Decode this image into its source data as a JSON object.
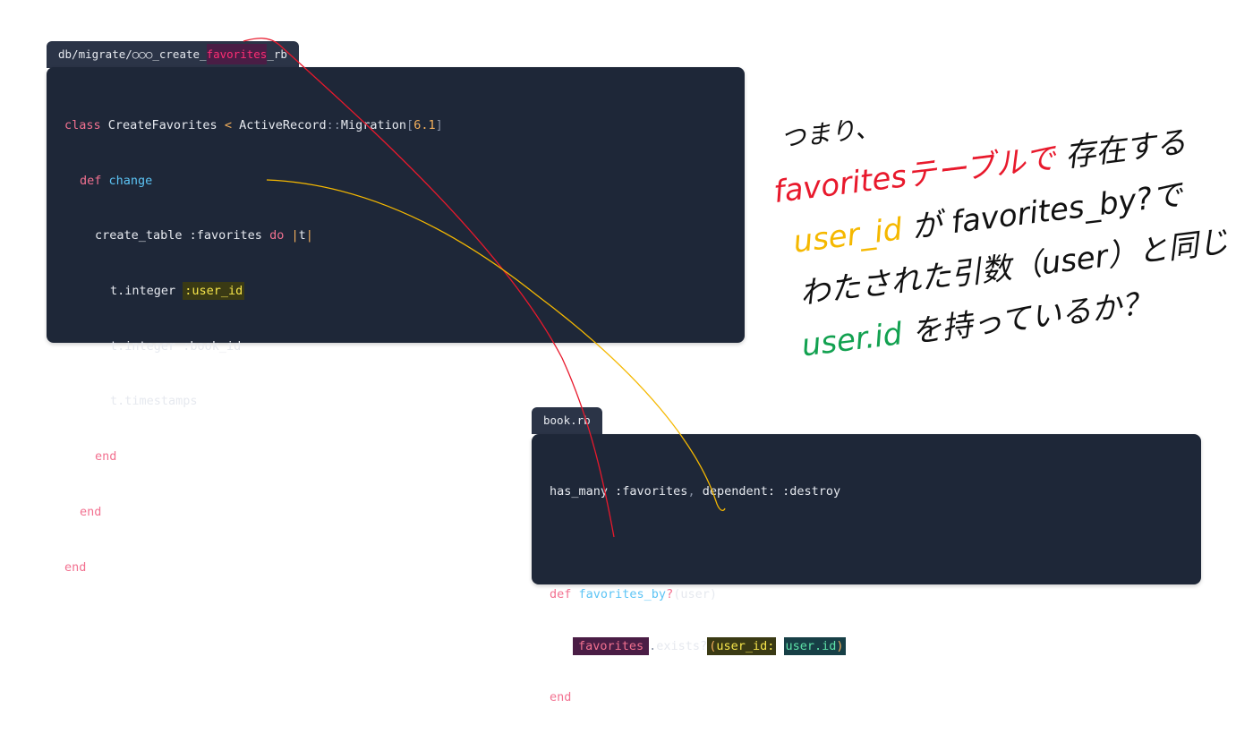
{
  "migration": {
    "tab_prefix": "db/migrate/○○○_create_",
    "tab_highlight": "favorites",
    "tab_suffix": "_rb",
    "lines": {
      "l1_kw": "class",
      "l1_name": " CreateFavorites ",
      "l1_lt": "<",
      "l1_base": " ActiveRecord",
      "l1_sep": "::",
      "l1_mig": "Migration",
      "l1_br_open": "[",
      "l1_ver": "6.1",
      "l1_br_close": "]",
      "l2_kw": "def",
      "l2_fn": "change",
      "l3_text": "create_table :favorites ",
      "l3_do": "do",
      "l3_pipe1": "|",
      "l3_t": "t",
      "l3_pipe2": "|",
      "l4_text": "t.integer ",
      "l4_sym": ":user_id",
      "l5_text": "t.integer :book_id",
      "l6_text": "t.timestamps",
      "l7_end": "end",
      "l8_end": "end",
      "l9_end": "end"
    }
  },
  "book": {
    "tab_label": "book.rb",
    "lines": {
      "l1_text": "has_many :favorites",
      "l1_comma": ",",
      "l1_rest": " dependent: :destroy",
      "l3_kw": "def",
      "l3_fn": "favorites_by",
      "l3_q": "?",
      "l3_args": "(user)",
      "l4_recv": "favorites",
      "l4_dot": ".",
      "l4_call": "exists?",
      "l4_open": "(",
      "l4_key": "user_id:",
      "l4_val": "user.id",
      "l4_close": ")",
      "l5_end": "end"
    }
  },
  "annotation": {
    "line1": "つまり、",
    "line2_red": "favoritesテーブルで",
    "line2_black": "存在する",
    "line3_yellow": "user_id",
    "line3_black": "が favorites_by?で",
    "line4": "わたされた引数（user）と同じ",
    "line5_green": "user.id",
    "line5_black": "を持っているか？",
    "colors": {
      "red": "#e8192c",
      "yellow": "#f5b800",
      "green": "#12a150",
      "black": "#111111"
    }
  }
}
